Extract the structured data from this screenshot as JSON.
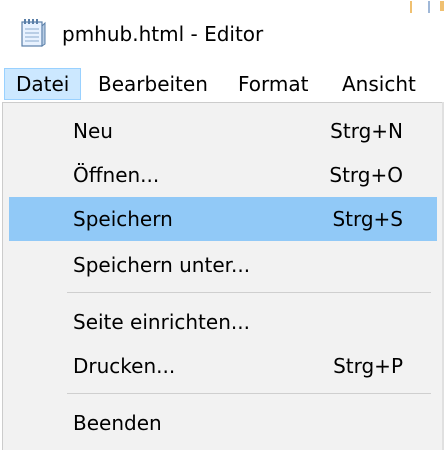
{
  "window": {
    "title": "pmhub.html - Editor",
    "icon": "notepad-icon"
  },
  "menubar": {
    "items": [
      {
        "label": "Datei",
        "active": true
      },
      {
        "label": "Bearbeiten"
      },
      {
        "label": "Format"
      },
      {
        "label": "Ansicht"
      }
    ]
  },
  "dropdown": {
    "items": [
      {
        "label": "Neu",
        "shortcut": "Strg+N"
      },
      {
        "label": "Öffnen...",
        "shortcut": "Strg+O"
      },
      {
        "label": "Speichern",
        "shortcut": "Strg+S",
        "highlighted": true
      },
      {
        "label": "Speichern unter...",
        "shortcut": ""
      },
      {
        "label": "Seite einrichten...",
        "shortcut": ""
      },
      {
        "label": "Drucken...",
        "shortcut": "Strg+P"
      },
      {
        "label": "Beenden",
        "shortcut": ""
      }
    ]
  },
  "colors": {
    "menu_active_bg": "#cce8ff",
    "menu_active_border": "#99d1ff",
    "dropdown_bg": "#f2f2f2",
    "highlight_bg": "#91c9f7"
  }
}
